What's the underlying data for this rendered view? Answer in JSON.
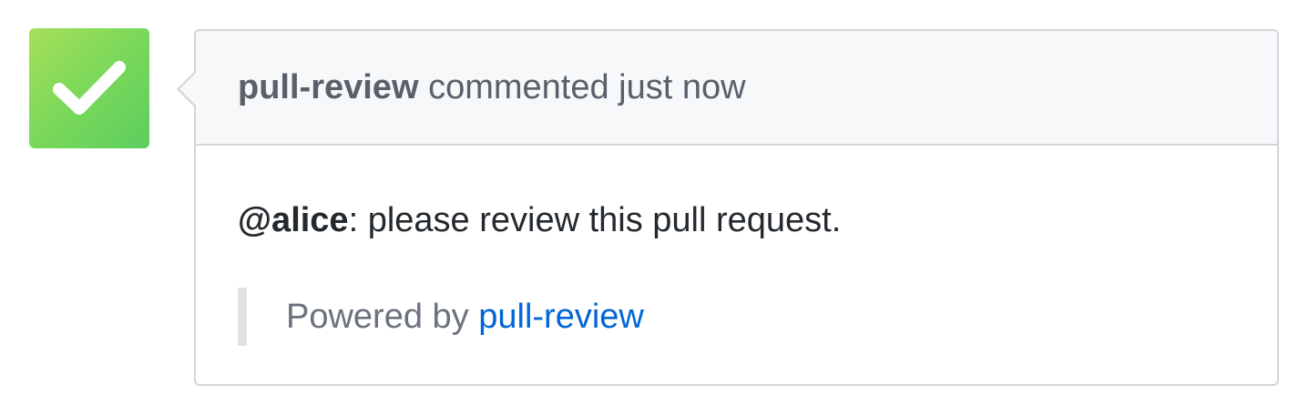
{
  "avatar": {
    "icon": "checkmark-icon",
    "gradient_start": "#a6e05a",
    "gradient_end": "#5cce5e"
  },
  "comment": {
    "author": "pull-review",
    "action": "commented",
    "time": "just now",
    "mention": "@alice",
    "message": ": please review this pull request.",
    "footer_prefix": "Powered by",
    "footer_link": "pull-review"
  },
  "colors": {
    "header_bg": "#f6f8fa",
    "border": "#d1d5da",
    "link": "#0366d6",
    "muted_text": "#586069",
    "body_text": "#24292e"
  }
}
